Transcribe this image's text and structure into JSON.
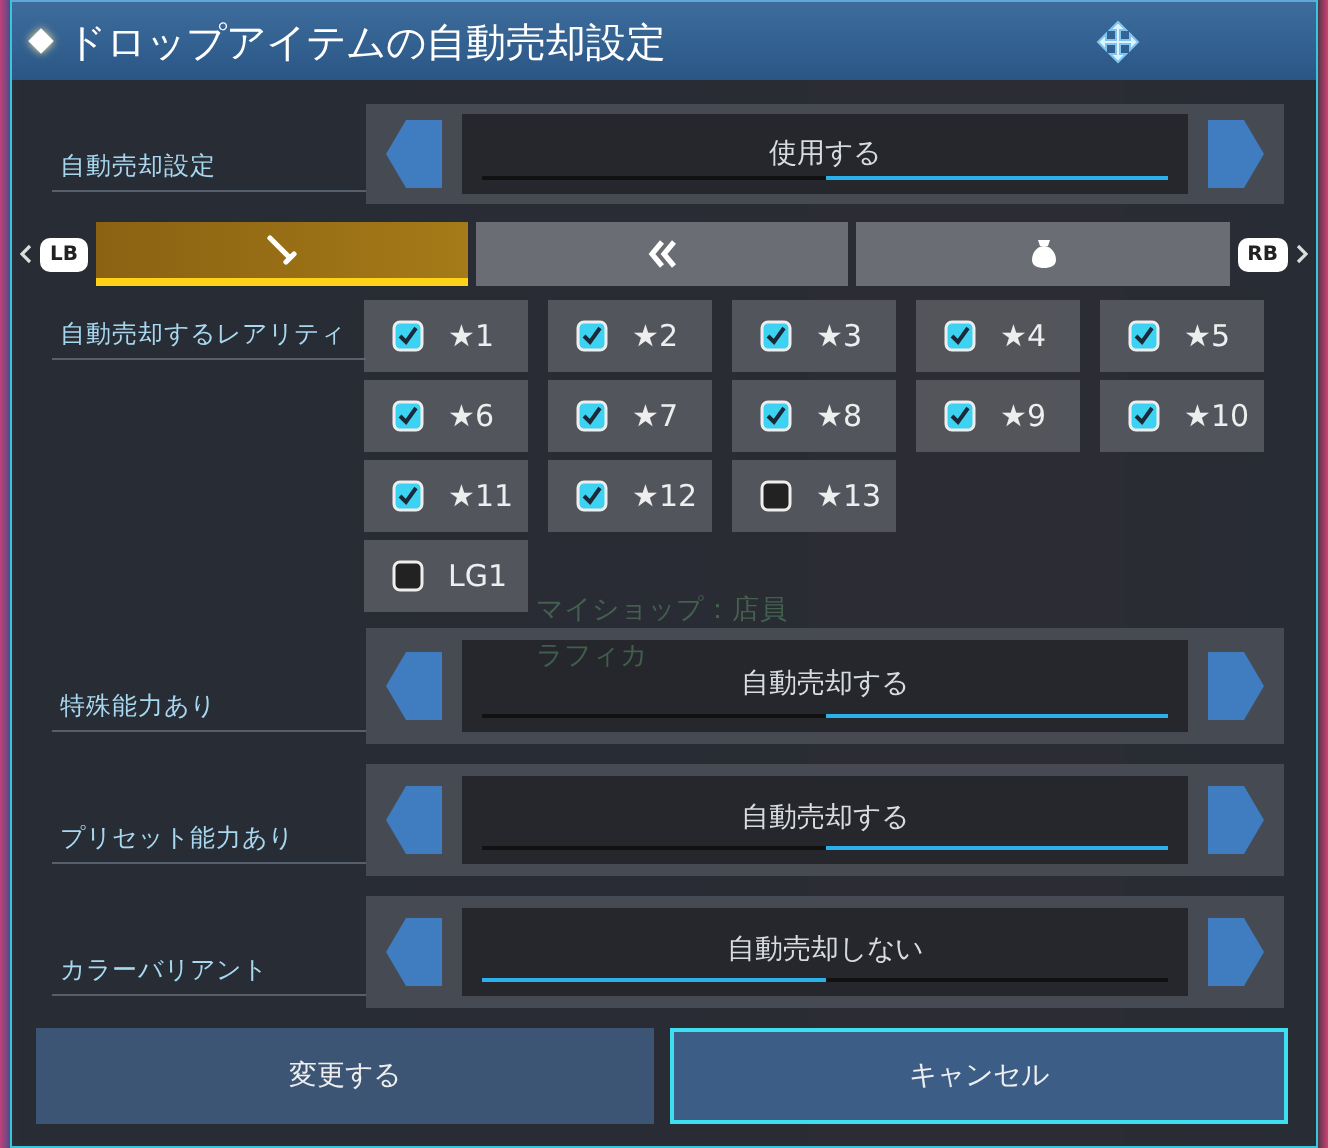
{
  "window": {
    "title": "ドロップアイテムの自動売却設定"
  },
  "auto_sell": {
    "label": "自動売却設定",
    "value": "使用する",
    "kind": "last"
  },
  "tabs": [
    {
      "selected": true
    },
    {
      "selected": false
    },
    {
      "selected": false
    }
  ],
  "tab_hints": {
    "left": "LB",
    "right": "RB"
  },
  "rarity": {
    "label": "自動売却するレアリティ",
    "rows": [
      [
        {
          "label": "★1",
          "checked": true
        },
        {
          "label": "★2",
          "checked": true
        },
        {
          "label": "★3",
          "checked": true
        },
        {
          "label": "★4",
          "checked": true
        },
        {
          "label": "★5",
          "checked": true
        }
      ],
      [
        {
          "label": "★6",
          "checked": true
        },
        {
          "label": "★7",
          "checked": true
        },
        {
          "label": "★8",
          "checked": true
        },
        {
          "label": "★9",
          "checked": true
        },
        {
          "label": "★10",
          "checked": true
        }
      ],
      [
        {
          "label": "★11",
          "checked": true
        },
        {
          "label": "★12",
          "checked": true
        },
        {
          "label": "★13",
          "checked": false
        }
      ],
      [
        {
          "label": "LG1",
          "checked": false
        }
      ]
    ]
  },
  "background_label": [
    "マイショップ：店員",
    "ラフィカ"
  ],
  "options": [
    {
      "label": "特殊能力あり",
      "value": "自動売却する",
      "kind": "last"
    },
    {
      "label": "プリセット能力あり",
      "value": "自動売却する",
      "kind": "last"
    },
    {
      "label": "カラーバリアント",
      "value": "自動売却しない",
      "kind": "first"
    }
  ],
  "buttons": [
    {
      "label": "変更する",
      "selected": false
    },
    {
      "label": "キャンセル",
      "selected": true
    }
  ]
}
